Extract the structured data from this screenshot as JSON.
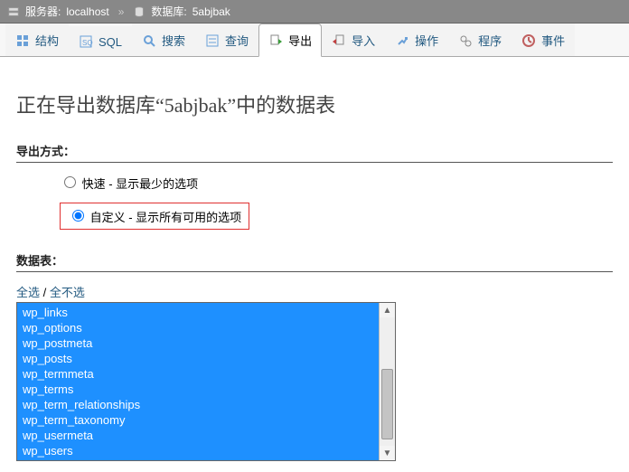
{
  "breadcrumb": {
    "server_label": "服务器: ",
    "server_value": "localhost",
    "db_label": "数据库: ",
    "db_value": "5abjbak"
  },
  "tabs": [
    {
      "label": "结构"
    },
    {
      "label": "SQL"
    },
    {
      "label": "搜索"
    },
    {
      "label": "查询"
    },
    {
      "label": "导出"
    },
    {
      "label": "导入"
    },
    {
      "label": "操作"
    },
    {
      "label": "程序"
    },
    {
      "label": "事件"
    }
  ],
  "active_tab": 4,
  "page_title": "正在导出数据库“5abjbak”中的数据表",
  "export_method": {
    "heading": "导出方式：",
    "options": [
      {
        "label": "快速 - 显示最少的选项",
        "checked": false
      },
      {
        "label": "自定义 - 显示所有可用的选项",
        "checked": true
      }
    ]
  },
  "tables": {
    "heading": "数据表：",
    "select_all": "全选",
    "select_all_sep": " / ",
    "deselect_all": "全不选",
    "items": [
      "wp_links",
      "wp_options",
      "wp_postmeta",
      "wp_posts",
      "wp_termmeta",
      "wp_terms",
      "wp_term_relationships",
      "wp_term_taxonomy",
      "wp_usermeta",
      "wp_users"
    ]
  }
}
